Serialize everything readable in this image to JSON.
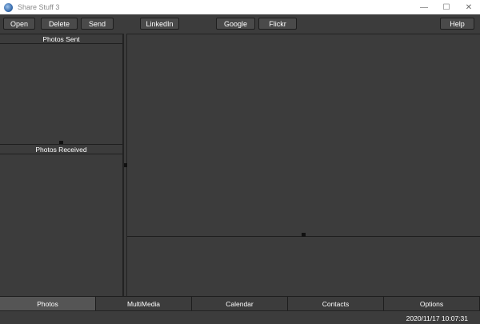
{
  "window": {
    "title": "Share Stuff 3",
    "minimize_glyph": "—",
    "maximize_glyph": "☐",
    "close_glyph": "✕"
  },
  "toolbar": {
    "open_label": "Open",
    "delete_label": "Delete",
    "send_label": "Send",
    "linkedin_label": "LinkedIn",
    "google_label": "Google",
    "flickr_label": "Flickr",
    "help_label": "Help"
  },
  "left_panel": {
    "sent_header": "Photos Sent",
    "received_header": "Photos Received"
  },
  "tabs": [
    {
      "label": "Photos",
      "active": true
    },
    {
      "label": "MultiMedia",
      "active": false
    },
    {
      "label": "Calendar",
      "active": false
    },
    {
      "label": "Contacts",
      "active": false
    },
    {
      "label": "Options",
      "active": false
    }
  ],
  "status": {
    "datetime": "2020/11/17 10:07:31"
  },
  "colors": {
    "background": "#3c3c3c",
    "active_tab": "#555555",
    "text": "#ffffff"
  }
}
